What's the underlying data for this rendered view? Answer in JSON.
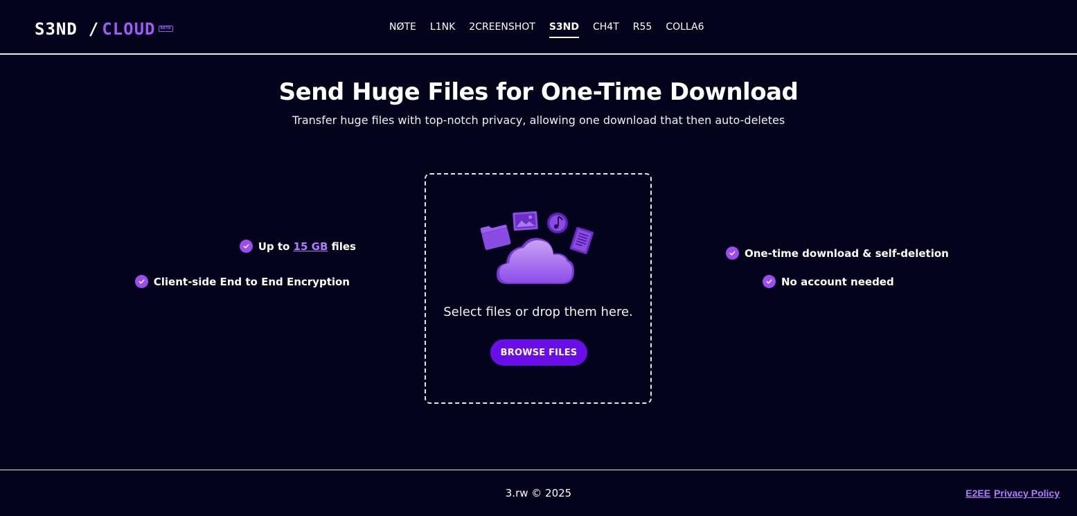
{
  "header": {
    "logo": {
      "left": "S3ND",
      "slash": "/",
      "right": "CLOUD",
      "badge": "BETA"
    },
    "nav": [
      {
        "label": "NØTE",
        "active": false
      },
      {
        "label": "L1NK",
        "active": false
      },
      {
        "label": "2CREENSHOT",
        "active": false
      },
      {
        "label": "S3ND",
        "active": true
      },
      {
        "label": "CH4T",
        "active": false
      },
      {
        "label": "R55",
        "active": false
      },
      {
        "label": "COLLA6",
        "active": false
      }
    ]
  },
  "hero": {
    "title": "Send Huge Files for One-Time Download",
    "subtitle": "Transfer huge files with top-notch privacy, allowing one download that then auto-deletes"
  },
  "features": {
    "size_prefix": "Up to",
    "size_value": "15 GB",
    "size_suffix": "files",
    "encryption": "Client-side End to End Encryption",
    "one_time": "One-time download & self-deletion",
    "no_account": "No account needed"
  },
  "dropzone": {
    "text": "Select files or drop them here.",
    "button_label": "BROWSE FILES"
  },
  "footer": {
    "copyright": "3.rw © 2025",
    "links": [
      "E2EE",
      "Privacy Policy"
    ]
  },
  "colors": {
    "background": "#03031c",
    "accent": "#9d5cf5",
    "button": "#6a0ee8",
    "link": "#b57bff"
  }
}
